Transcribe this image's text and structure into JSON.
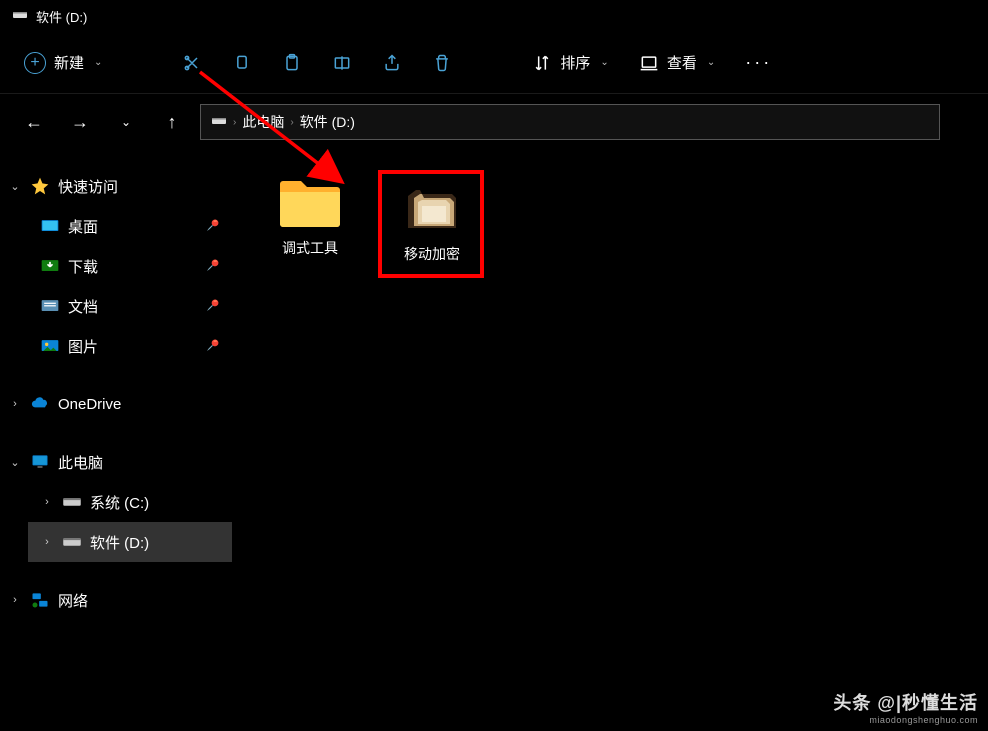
{
  "window": {
    "title": "软件 (D:)"
  },
  "toolbar": {
    "new_label": "新建",
    "sort_label": "排序",
    "view_label": "查看"
  },
  "breadcrumb": {
    "root": "此电脑",
    "current": "软件 (D:)"
  },
  "sidebar": {
    "quick_access": "快速访问",
    "desktop": "桌面",
    "downloads": "下载",
    "documents": "文档",
    "pictures": "图片",
    "onedrive": "OneDrive",
    "this_pc": "此电脑",
    "drive_c": "系统 (C:)",
    "drive_d": "软件 (D:)",
    "network": "网络"
  },
  "files": {
    "folder1": "调式工具",
    "folder2": "移动加密"
  },
  "watermark": {
    "main": "头条 @|秒懂生活",
    "sub": "miaodongshenghuo.com"
  }
}
